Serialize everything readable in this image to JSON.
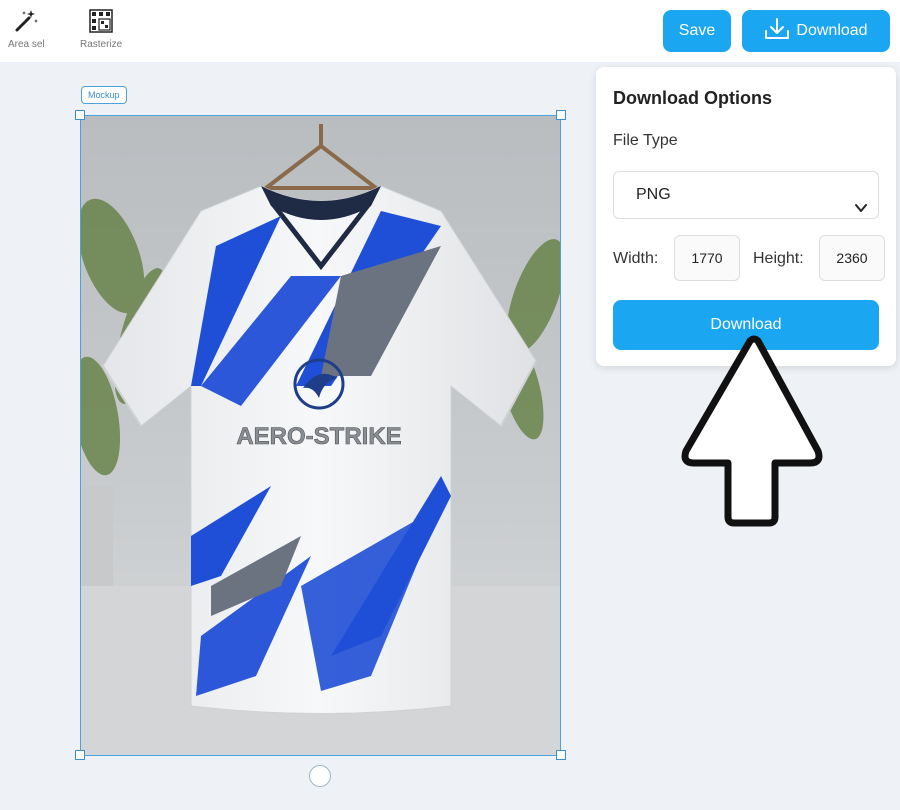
{
  "toolbar": {
    "area_select_label": "Area sel",
    "rasterize_label": "Rasterize",
    "save_label": "Save",
    "download_label": "Download"
  },
  "canvas": {
    "mockup_tag": "Mockup",
    "jersey_brand_text": "AERO-STRIKE"
  },
  "download_panel": {
    "title": "Download Options",
    "file_type_label": "File Type",
    "file_type_value": "PNG",
    "width_label": "Width:",
    "width_value": "1770",
    "height_label": "Height:",
    "height_value": "2360",
    "download_button_label": "Download"
  },
  "colors": {
    "accent": "#1ba6f2",
    "selection": "#4aa3df",
    "jersey_blue": "#1f4fd6",
    "jersey_gray": "#6b7280"
  },
  "icons": {
    "area_select": "magic-wand-icon",
    "rasterize": "grid-icon",
    "download": "download-icon",
    "file_type_dropdown": "chevron-down-icon",
    "annotation": "arrow-up-pointer-icon"
  }
}
